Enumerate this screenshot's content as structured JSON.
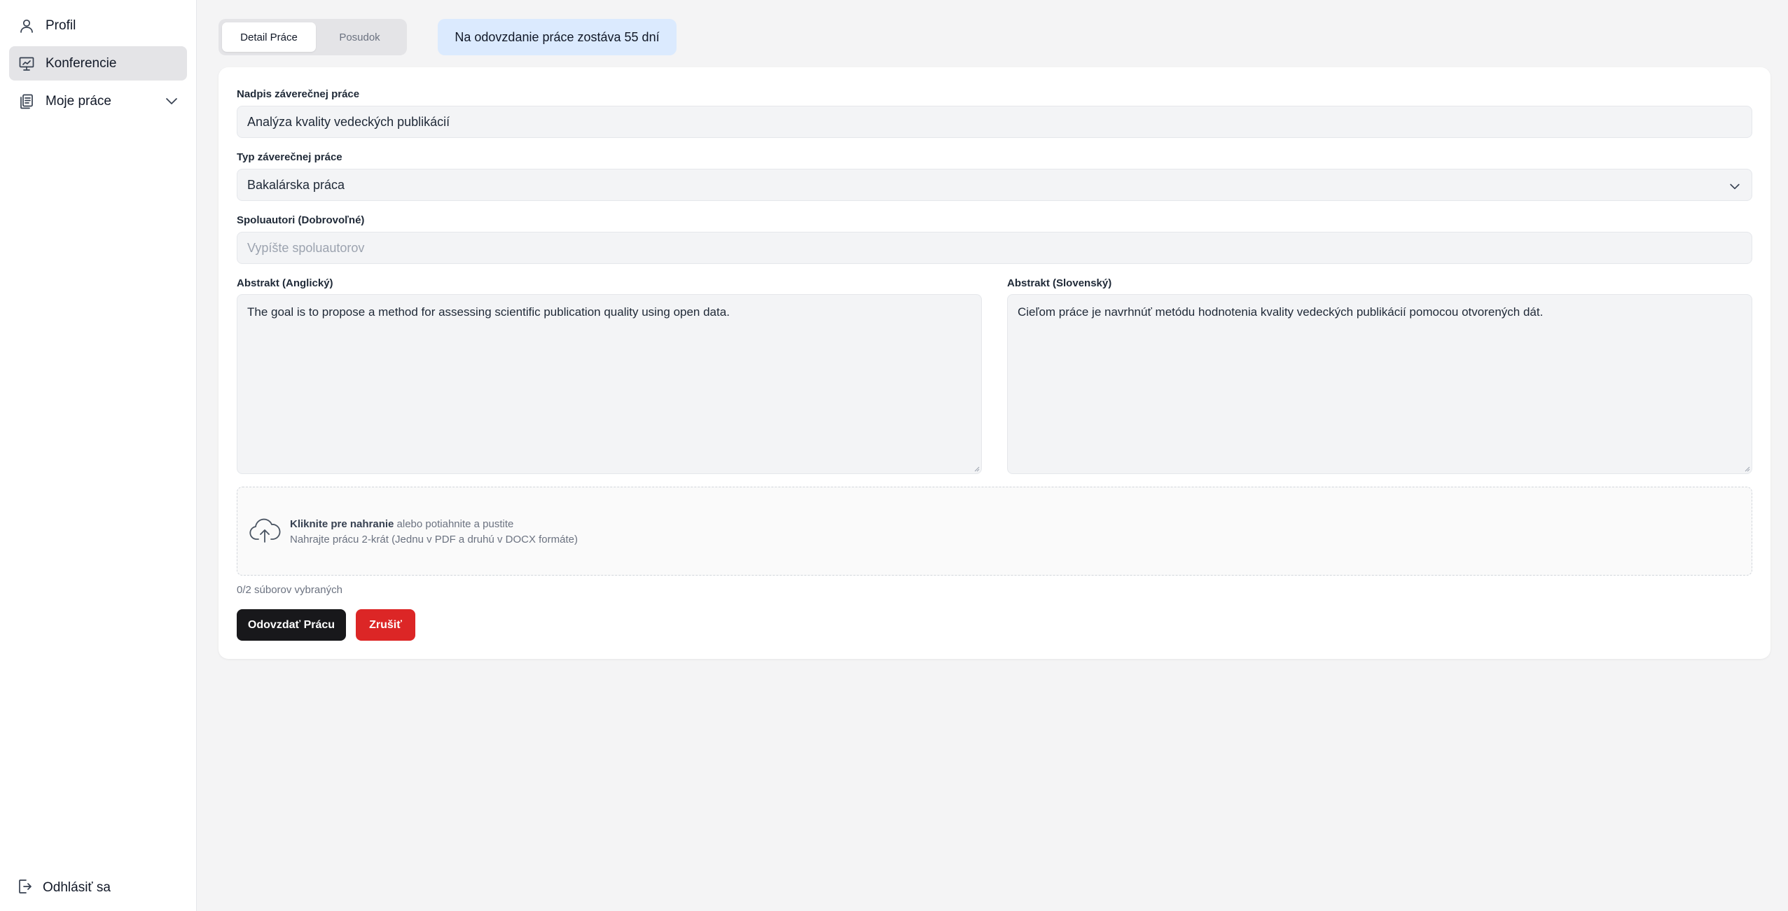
{
  "sidebar": {
    "items": [
      {
        "label": "Profil",
        "icon": "user-icon"
      },
      {
        "label": "Konferencie",
        "icon": "presentation-icon",
        "active": true
      },
      {
        "label": "Moje práce",
        "icon": "documents-icon"
      }
    ],
    "logout_label": "Odhlásiť sa"
  },
  "tabs": [
    {
      "label": "Detail Práce",
      "active": true
    },
    {
      "label": "Posudok",
      "active": false
    }
  ],
  "deadline_text": "Na odovzdanie práce zostáva 55 dní",
  "form": {
    "title": {
      "label": "Nadpis záverečnej práce",
      "value": "Analýza kvality vedeckých publikácií"
    },
    "type": {
      "label": "Typ záverečnej práce",
      "value": "Bakalárska práca"
    },
    "coauthors": {
      "label": "Spoluautori (Dobrovoľné)",
      "placeholder": "Vypíšte spoluautorov"
    },
    "abstract_en": {
      "label": "Abstrakt (Anglický)",
      "value": "The goal is to propose a method for assessing scientific publication quality using open data."
    },
    "abstract_sk": {
      "label": "Abstrakt (Slovenský)",
      "value": "Cieľom práce je navrhnúť metódu hodnotenia kvality vedeckých publikácií pomocou otvorených dát."
    },
    "upload": {
      "click_text": "Kliknite pre nahranie",
      "drag_text": " alebo potiahnite a pustite",
      "hint": "Nahrajte prácu 2-krát (Jednu v PDF a druhú v DOCX formáte)"
    },
    "files_count": "0/2 súborov vybraných",
    "submit_label": "Odovzdať Prácu",
    "cancel_label": "Zrušiť"
  },
  "colors": {
    "accent_dark": "#18181b",
    "danger": "#dc2626",
    "deadline_bg": "#dbeafe"
  }
}
